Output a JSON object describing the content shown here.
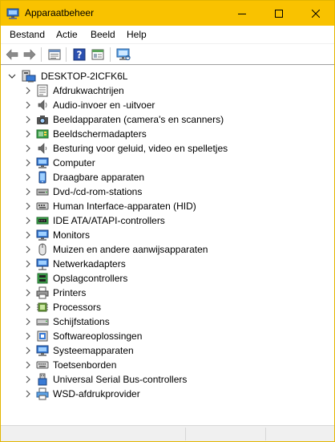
{
  "window": {
    "title": "Apparaatbeheer",
    "title_bar_color": "#f9c200",
    "controls": [
      "minimize-icon",
      "maximize-icon",
      "close-icon"
    ]
  },
  "menu": {
    "items": [
      "Bestand",
      "Actie",
      "Beeld",
      "Help"
    ]
  },
  "toolbar": {
    "buttons": [
      "back-arrow-icon",
      "forward-arrow-icon",
      "properties-icon",
      "help-icon",
      "view-icon",
      "scan-hardware-icon"
    ]
  },
  "tree": {
    "root": {
      "label": "DESKTOP-2ICFK6L",
      "icon": "computer-icon",
      "expanded": true
    },
    "nodes": [
      {
        "label": "Afdrukwachtrijen",
        "icon": "printer-queue-icon"
      },
      {
        "label": "Audio-invoer en -uitvoer",
        "icon": "speaker-icon"
      },
      {
        "label": "Beeldapparaten (camera's en scanners)",
        "icon": "camera-icon"
      },
      {
        "label": "Beeldschermadapters",
        "icon": "display-adapter-icon"
      },
      {
        "label": "Besturing voor geluid, video en spelletjes",
        "icon": "sound-icon"
      },
      {
        "label": "Computer",
        "icon": "monitor-icon"
      },
      {
        "label": "Draagbare apparaten",
        "icon": "portable-device-icon"
      },
      {
        "label": "Dvd-/cd-rom-stations",
        "icon": "disc-icon"
      },
      {
        "label": "Human Interface-apparaten (HID)",
        "icon": "hid-icon"
      },
      {
        "label": "IDE ATA/ATAPI-controllers",
        "icon": "ide-controller-icon"
      },
      {
        "label": "Monitors",
        "icon": "monitor-icon"
      },
      {
        "label": "Muizen en andere aanwijsapparaten",
        "icon": "mouse-icon"
      },
      {
        "label": "Netwerkadapters",
        "icon": "network-adapter-icon"
      },
      {
        "label": "Opslagcontrollers",
        "icon": "storage-controller-icon"
      },
      {
        "label": "Printers",
        "icon": "printer-icon"
      },
      {
        "label": "Processors",
        "icon": "processor-icon"
      },
      {
        "label": "Schijfstations",
        "icon": "disk-drive-icon"
      },
      {
        "label": "Softwareoplossingen",
        "icon": "software-icon"
      },
      {
        "label": "Systeemapparaten",
        "icon": "system-device-icon"
      },
      {
        "label": "Toetsenborden",
        "icon": "keyboard-icon"
      },
      {
        "label": "Universal Serial Bus-controllers",
        "icon": "usb-icon"
      },
      {
        "label": "WSD-afdrukprovider",
        "icon": "wsd-printer-icon"
      }
    ]
  }
}
